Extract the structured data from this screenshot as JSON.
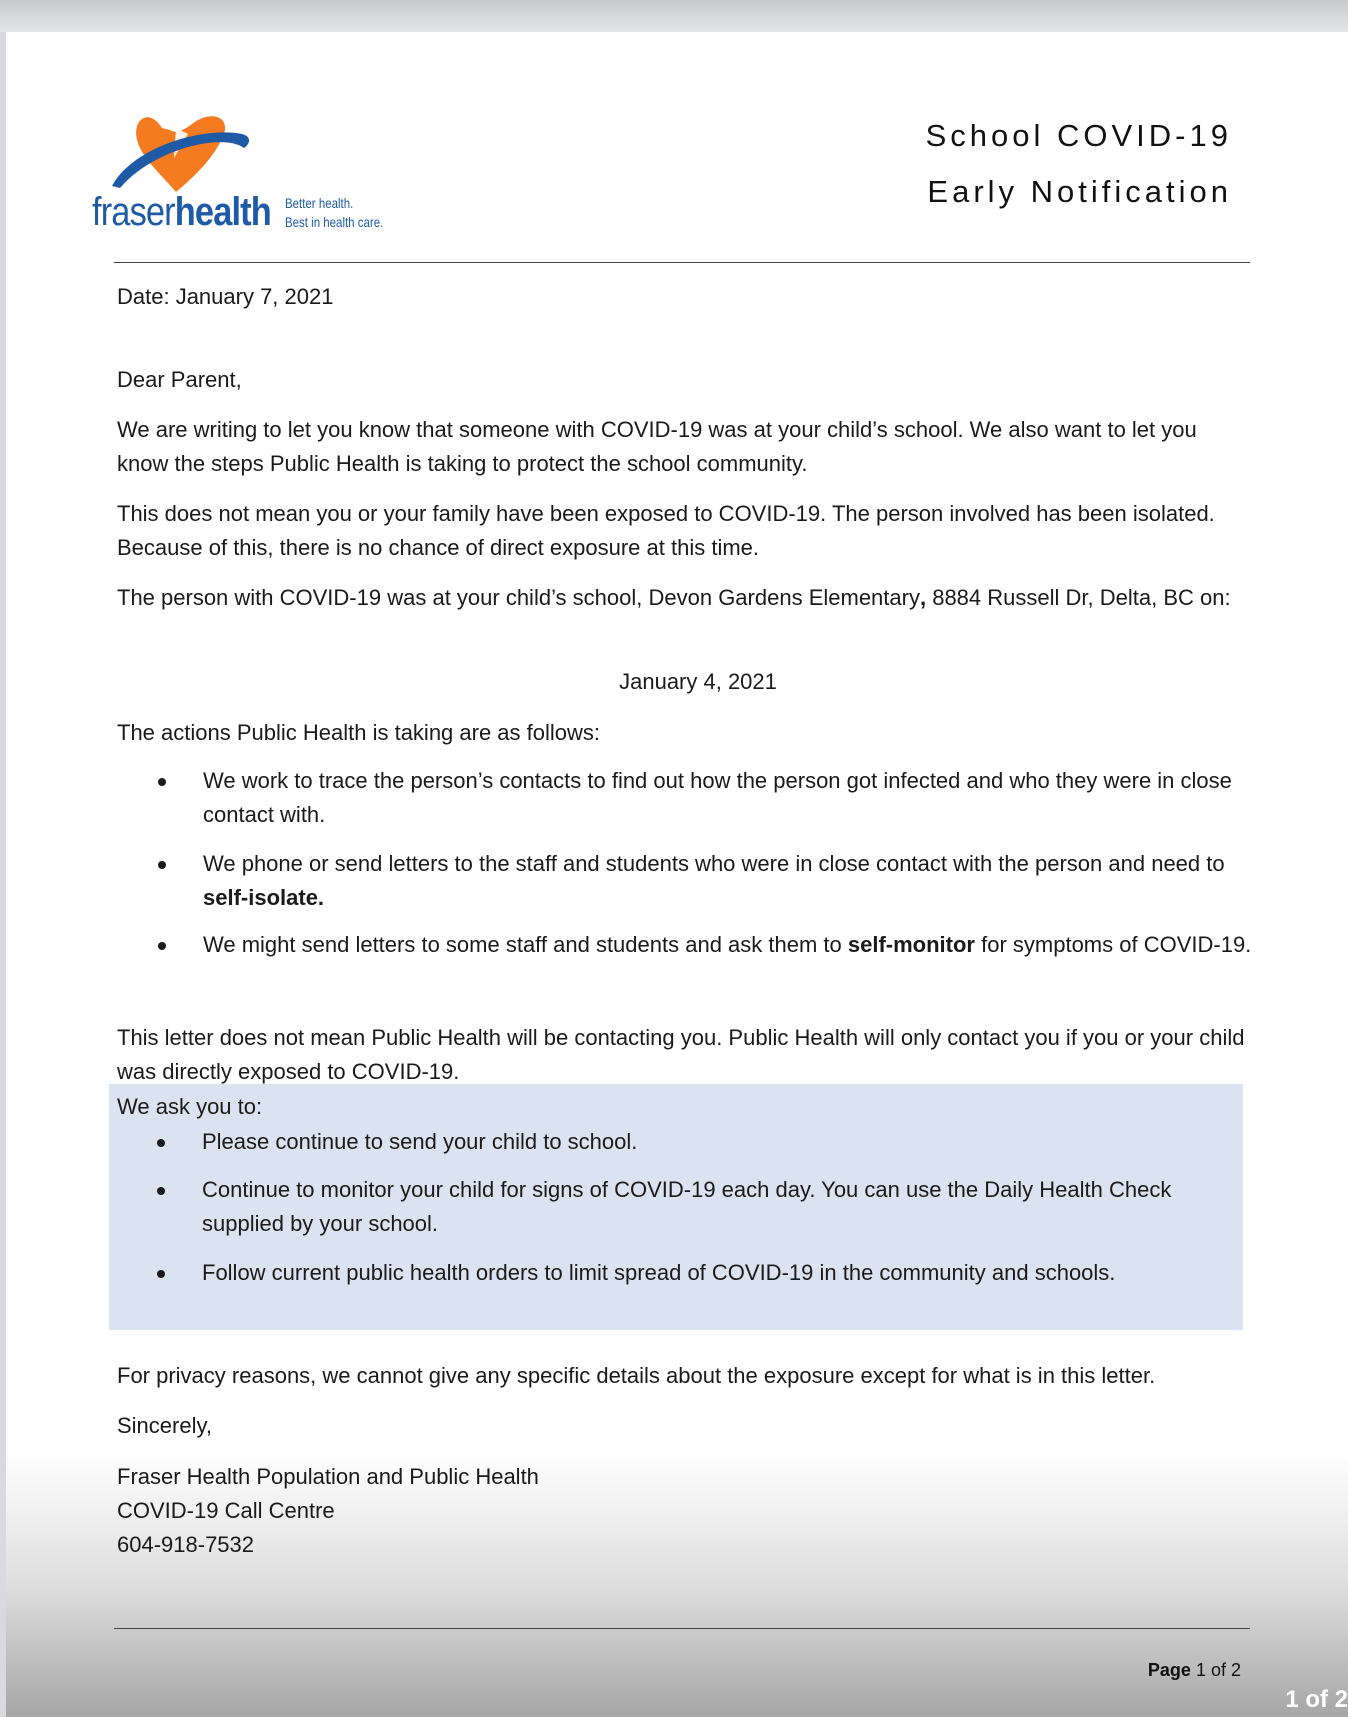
{
  "header": {
    "brand_light": "fraser",
    "brand_bold": "health",
    "tagline_line1": "Better health.",
    "tagline_line2": "Best in health care.",
    "title_line1": "School COVID-19",
    "title_line2": "Early Notification",
    "logo_colors": {
      "heart": "#f47b20",
      "swoosh": "#1f5aa6"
    }
  },
  "letter": {
    "date": "Date: January 7, 2021",
    "greeting": "Dear Parent,",
    "p1": "We are writing to let you know that someone with COVID-19 was at your child’s school. We also want to let you know the steps Public Health is taking to protect the school community.",
    "p2": "This does not mean you or your family have been exposed to COVID-19. The person involved has been isolated. Because of this, there is no chance of direct exposure at this time.",
    "p3_start": "The person with COVID-19 was at your child’s school, Devon Gardens Elementary",
    "p3_comma": ",",
    "p3_end": " 8884 Russell Dr, Delta, BC on:",
    "exposure_date": "January 4, 2021",
    "actions_intro": "The actions Public Health is taking are as follows:",
    "actions": [
      {
        "text": "We work to trace the person’s contacts to find out how the person got infected and who they were in close contact with."
      },
      {
        "pre": "We phone or send letters to the staff and students who were in close contact with the person and need to ",
        "bold": "self-isolate.",
        "post": ""
      },
      {
        "pre": "We might send letters to some staff and students and ask them to ",
        "bold": "self-monitor",
        "post": " for symptoms of COVID-19."
      }
    ],
    "p4": "This letter does not mean Public Health will be contacting you. Public Health will only contact you if you or your child was directly exposed to COVID-19.",
    "ask_intro": "We ask you to:",
    "asks": [
      "Please continue to send your child to school.",
      "Continue to monitor your child for signs of COVID-19 each day.  You can use the Daily Health Check supplied by your school.",
      "Follow current public health orders to limit spread of COVID-19 in the community and schools."
    ],
    "privacy": "For privacy reasons, we cannot give any specific details about the exposure except for what is in this letter.",
    "closing": "Sincerely,",
    "signature": [
      "Fraser Health Population and Public Health",
      "COVID-19 Call Centre",
      "604-918-7532"
    ],
    "box_color": "#dce3f0"
  },
  "footer": {
    "page_label": "Page",
    "page_of": "1 of 2"
  },
  "viewer": {
    "page_counter": "1 of 2"
  }
}
